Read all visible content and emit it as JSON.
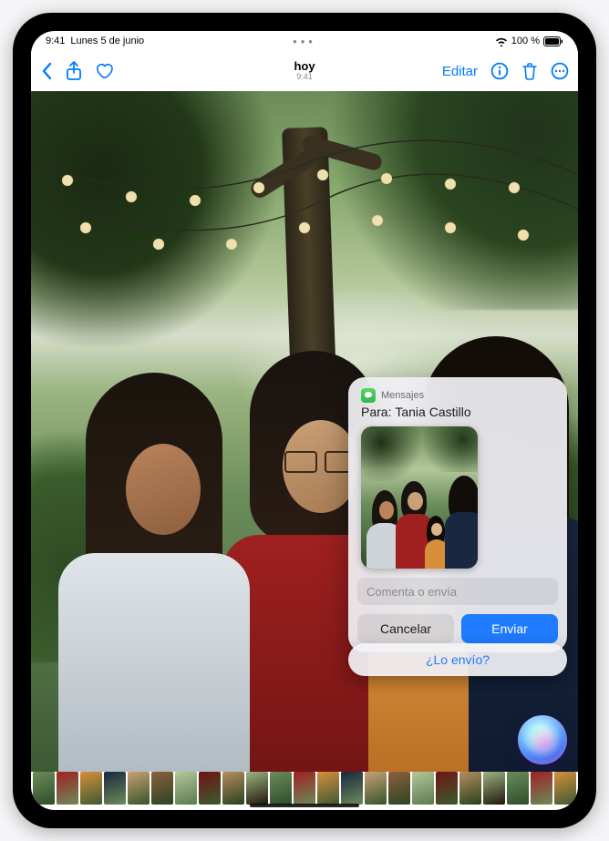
{
  "status": {
    "time": "9:41",
    "date": "Lunes 5 de junio",
    "battery": "100 %",
    "wifi_icon": "wifi",
    "battery_icon": "battery-full"
  },
  "nav": {
    "title": "hoy",
    "subtitle": "9:41",
    "edit_label": "Editar"
  },
  "share": {
    "app_label": "Mensajes",
    "to_prefix": "Para: ",
    "to_name": "Tania Castillo",
    "input_placeholder": "Comenta o envía",
    "cancel_label": "Cancelar",
    "send_label": "Enviar"
  },
  "siri": {
    "suggestion": "¿Lo envío?"
  },
  "colors": {
    "accent": "#007aff",
    "send": "#1f7bff",
    "messages_green": "#34c759"
  }
}
